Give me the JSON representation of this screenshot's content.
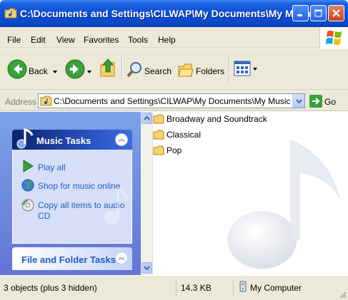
{
  "window": {
    "title": "C:\\Documents and Settings\\CILWAP\\My Documents\\My Music"
  },
  "menu": {
    "items": [
      "File",
      "Edit",
      "View",
      "Favorites",
      "Tools",
      "Help"
    ]
  },
  "toolbar": {
    "back_label": "Back",
    "search_label": "Search",
    "folders_label": "Folders"
  },
  "address": {
    "label": "Address",
    "value": "C:\\Documents and Settings\\CILWAP\\My Documents\\My Music",
    "go_label": "Go"
  },
  "tasks": {
    "music_title": "Music Tasks",
    "music_items": [
      "Play all",
      "Shop for music online",
      "Copy all items to audio CD"
    ],
    "folder_title": "File and Folder Tasks"
  },
  "files": [
    "Broadway and Soundtrack",
    "Classical",
    "Pop"
  ],
  "status": {
    "objects": "3 objects (plus 3 hidden)",
    "size": "14.3 KB",
    "location": "My Computer"
  },
  "colors": {
    "title_bar": "#0a4fd6",
    "task_link": "#215dc6",
    "chrome": "#ece9d8"
  }
}
